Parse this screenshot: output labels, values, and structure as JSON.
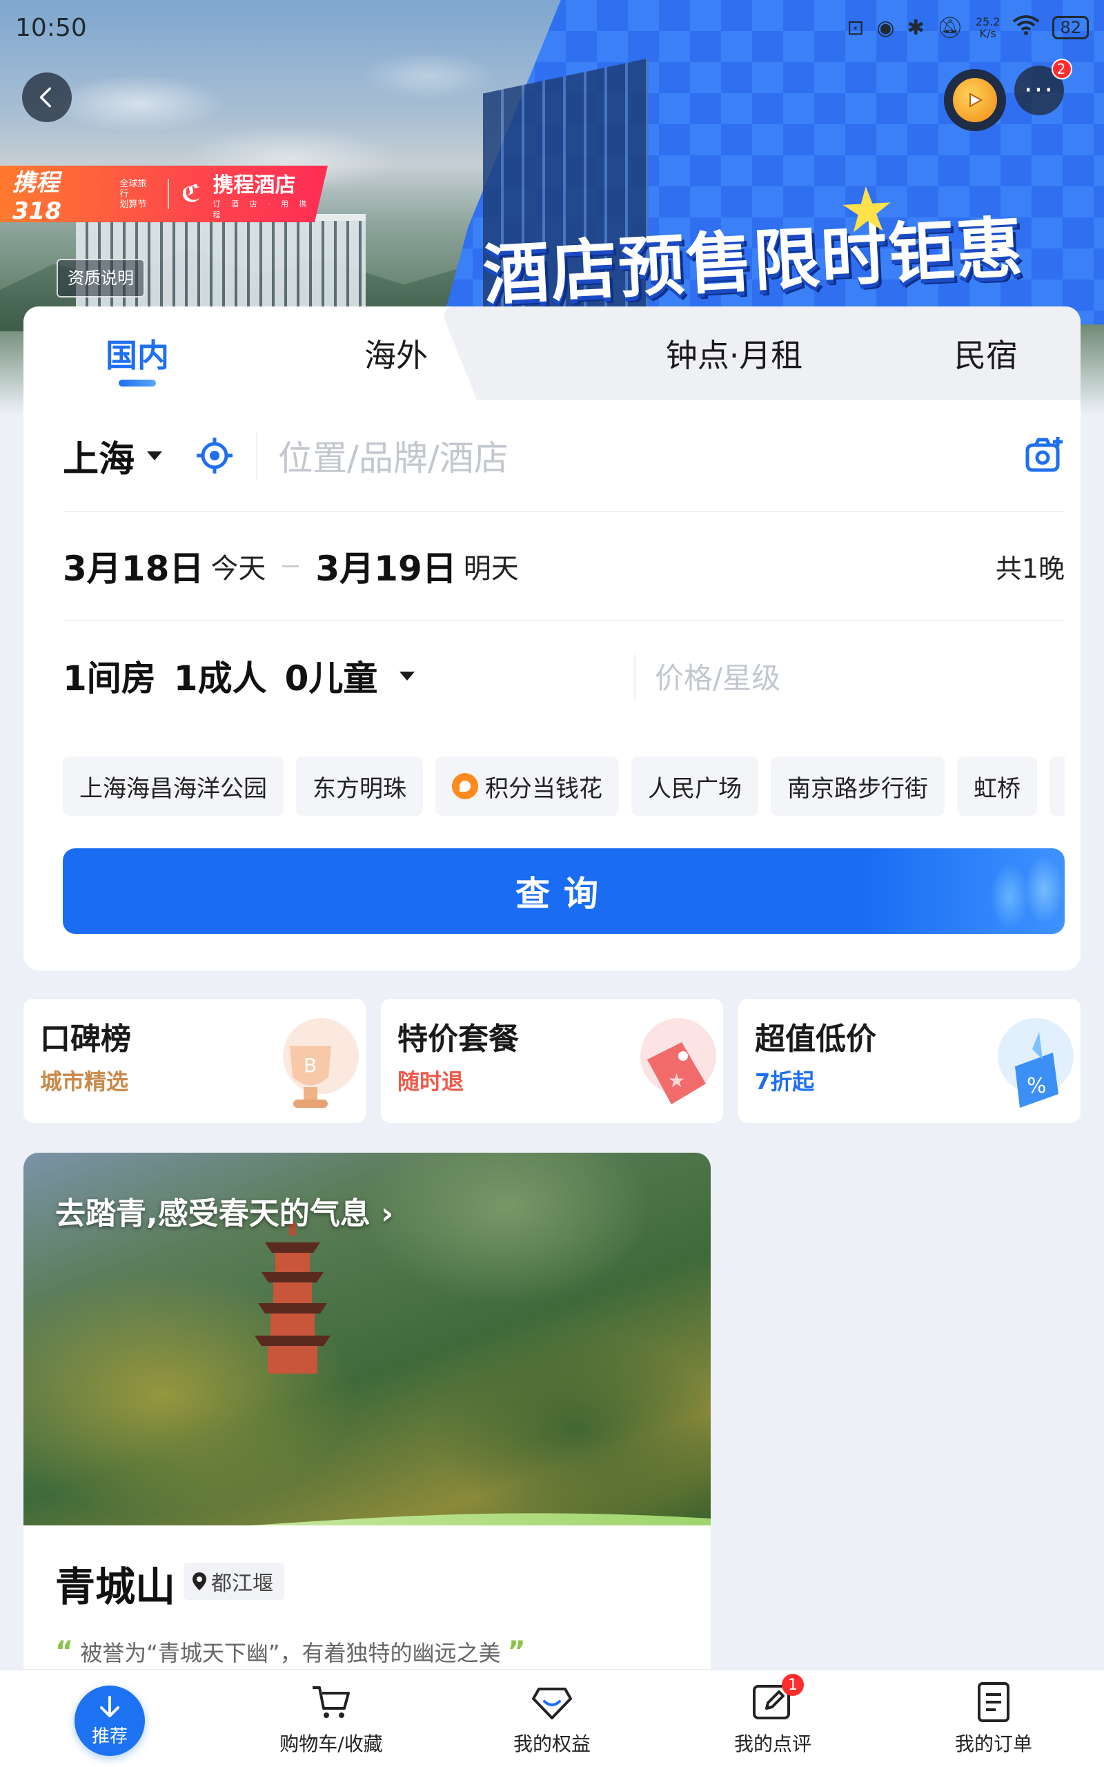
{
  "status_bar": {
    "time": "10:50",
    "net_speed_value": "25.2",
    "net_speed_unit": "K/s",
    "battery": "82"
  },
  "hero": {
    "brand_campaign": "携程318",
    "brand_campaign_sub_1": "全球旅行",
    "brand_campaign_sub_2": "划算节",
    "brand_name": "携程酒店",
    "brand_slogan": "订 酒 店 · 用 携 程",
    "qualification_label": "资质说明",
    "headline": "酒店预售限时钜惠",
    "more_badge": "2"
  },
  "search": {
    "tabs": [
      {
        "label": "国内"
      },
      {
        "label": "海外"
      },
      {
        "label": "钟点·月租"
      },
      {
        "label": "民宿"
      }
    ],
    "city": "上海",
    "keyword_placeholder": "位置/品牌/酒店",
    "checkin_date": "3月18日",
    "checkin_day": "今天",
    "checkout_date": "3月19日",
    "checkout_day": "明天",
    "nights": "共1晚",
    "rooms": "1间房",
    "adults": "1成人",
    "children": "0儿童",
    "price_placeholder": "价格/星级",
    "chips": [
      {
        "label": "上海海昌海洋公园"
      },
      {
        "label": "东方明珠"
      },
      {
        "label": "积分当钱花"
      },
      {
        "label": "人民广场"
      },
      {
        "label": "南京路步行街"
      },
      {
        "label": "虹桥"
      }
    ],
    "search_button": "查询"
  },
  "features": [
    {
      "title": "口碑榜",
      "subtitle": "城市精选",
      "subtitle_color": "#c9894a"
    },
    {
      "title": "特价套餐",
      "subtitle": "随时退",
      "subtitle_color": "#ef5a4a"
    },
    {
      "title": "超值低价",
      "subtitle": "7折起",
      "subtitle_color": "#1f6ff0"
    }
  ],
  "destination": {
    "theme": "去踏青,感受春天的气息",
    "name": "青城山",
    "location": "都江堰",
    "quote": "被誉为“青城天下幽”，有着独特的幽远之美"
  },
  "bottom_nav": {
    "home": "推荐",
    "cart": "购物车/收藏",
    "benefits": "我的权益",
    "reviews": "我的点评",
    "reviews_badge": "1",
    "orders": "我的订单"
  },
  "colors": {
    "accent": "#1f6ff0",
    "badge": "#ff2d2d"
  }
}
